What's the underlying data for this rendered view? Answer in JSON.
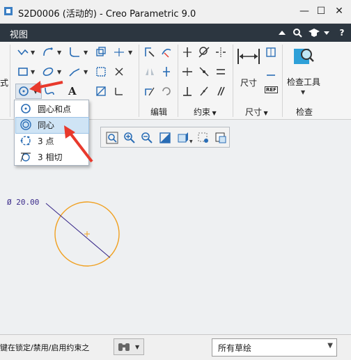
{
  "window": {
    "title": "S2D0006 (活动的) - Creo Parametric 9.0",
    "minimize_glyph": "—",
    "maximize_glyph": "☐",
    "close_glyph": "✕"
  },
  "menubar": {
    "tab_label": "视图",
    "icons": [
      "caret-up-icon",
      "search-icon",
      "graduation-cap-icon",
      "caret-down-icon",
      "help-icon"
    ],
    "help_glyph": "?"
  },
  "ribbon": {
    "left_cut_label": "式",
    "text_tool_glyph": "A",
    "groups": {
      "edit": "编辑",
      "constraints": "约束",
      "dimension": "尺寸",
      "inspect": "检查"
    },
    "dimension_button_label": "尺寸",
    "inspect_tool_label": "检查工具",
    "ref_label": "REF"
  },
  "popup": {
    "items": [
      {
        "label": "圆心和点",
        "icon": "circle-center-point-icon"
      },
      {
        "label": "同心",
        "icon": "concentric-circle-icon",
        "selected": true
      },
      {
        "label": "3 点",
        "icon": "three-point-circle-icon"
      },
      {
        "label": "3 相切",
        "icon": "three-tangent-circle-icon"
      }
    ]
  },
  "canvas": {
    "dimension_text": "Ø 20.00",
    "circle_color": "#f0a020",
    "line_color": "#3a2a8a"
  },
  "statusbar": {
    "message": "键在锁定/禁用/启用约束之",
    "filter_value": "所有草绘"
  },
  "colors": {
    "menubar_bg": "#2c3640",
    "arrow_red": "#e8392c",
    "selection_bg": "#cfe4f5"
  }
}
